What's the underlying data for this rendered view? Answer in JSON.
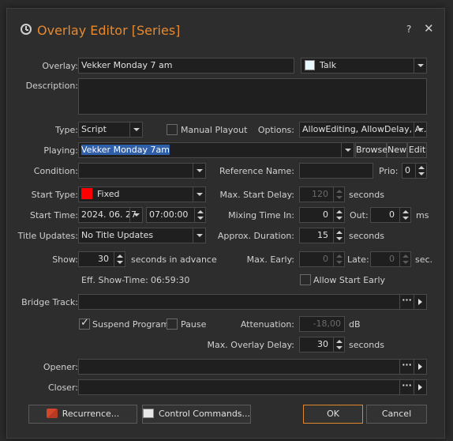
{
  "window": {
    "title": "Overlay Editor [Series]",
    "help": "?",
    "close": "✕"
  },
  "overlay": {
    "label": "Overlay:",
    "value": "Vekker Monday 7 am",
    "category_value": "Talk",
    "category_color": "#e8f8ff"
  },
  "description": {
    "label": "Description:",
    "value": ""
  },
  "type": {
    "label": "Type:",
    "value": "Script",
    "manual_playout_label": "Manual Playout",
    "manual_playout_checked": false,
    "options_label": "Options:",
    "options_value": "AllowEditing, AllowDelay, A…"
  },
  "playing": {
    "label": "Playing:",
    "value": "Vekker Monday 7am",
    "browse": "Browse",
    "new": "New",
    "edit": "Edit"
  },
  "condition": {
    "label": "Condition:",
    "value": "",
    "reference_label": "Reference Name:",
    "reference_value": "",
    "prio_label": "Prio:",
    "prio_value": "0"
  },
  "start_type": {
    "label": "Start Type:",
    "value": "Fixed",
    "color": "#ff0000",
    "max_start_delay_label": "Max. Start Delay:",
    "max_start_delay_value": "120",
    "max_start_delay_unit": "seconds"
  },
  "start_time": {
    "label": "Start Time:",
    "date": "2024. 06. 27",
    "time": "07:00:00",
    "mixing_label": "Mixing Time In:",
    "mixing_in": "0",
    "out_label": "Out:",
    "mixing_out": "0",
    "mixing_unit": "ms"
  },
  "title_updates": {
    "label": "Title Updates:",
    "value": "No Title Updates",
    "approx_label": "Approx. Duration:",
    "approx_value": "15",
    "approx_unit": "seconds"
  },
  "show": {
    "label": "Show:",
    "value": "30",
    "unit": "seconds in advance",
    "max_early_label": "Max. Early:",
    "max_early_value": "0",
    "late_label": "Late:",
    "late_value": "0",
    "late_unit": "sec."
  },
  "eff_show": {
    "label": "Eff. Show-Time:",
    "value": "06:59:30",
    "allow_early_label": "Allow Start Early",
    "allow_early_checked": false
  },
  "bridge_track": {
    "label": "Bridge Track:",
    "value": "",
    "dots": "···"
  },
  "suspend": {
    "suspend_label": "Suspend Program",
    "suspend_checked": true,
    "pause_label": "Pause",
    "pause_checked": false,
    "attenuation_label": "Attenuation:",
    "attenuation_value": "-18,00",
    "attenuation_unit": "dB"
  },
  "max_overlay_delay": {
    "label": "Max. Overlay Delay:",
    "value": "30",
    "unit": "seconds"
  },
  "opener": {
    "label": "Opener:",
    "value": "",
    "dots": "···"
  },
  "closer": {
    "label": "Closer:",
    "value": "",
    "dots": "···"
  },
  "buttons": {
    "recurrence": "Recurrence...",
    "control_commands": "Control Commands...",
    "ok": "OK",
    "cancel": "Cancel"
  }
}
